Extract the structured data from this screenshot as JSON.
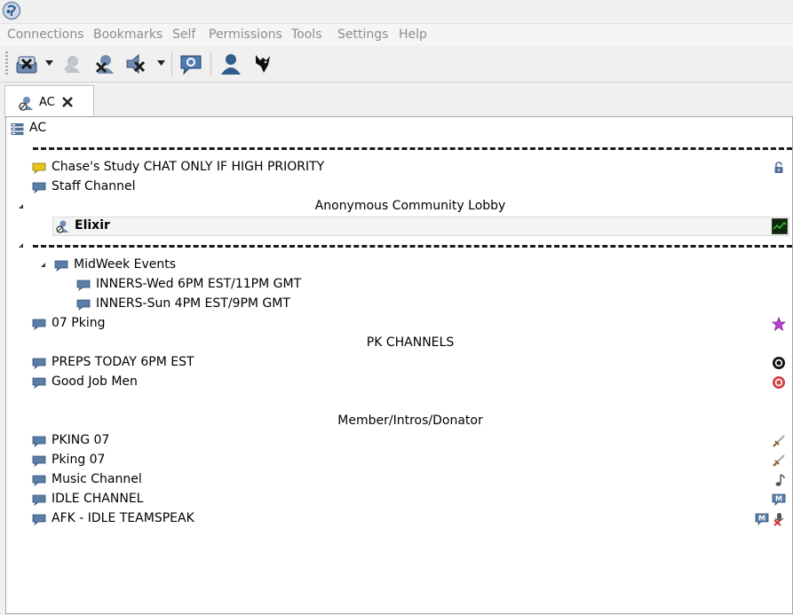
{
  "menu": {
    "connections": "Connections",
    "bookmarks": "Bookmarks",
    "self": "Self",
    "permissions": "Permissions",
    "tools": "Tools",
    "settings": "Settings",
    "help": "Help"
  },
  "tab": {
    "label": "AC"
  },
  "tree": {
    "server_name": "AC",
    "channels": {
      "chase_study": "Chase's Study CHAT ONLY IF HIGH PRIORITY",
      "staff": "Staff Channel",
      "lobby_header": "Anonymous Community Lobby",
      "client_elixir": "Elixir",
      "midweek": "MidWeek Events",
      "inners_wed": "INNERS-Wed 6PM EST/11PM GMT",
      "inners_sun": "INNERS-Sun 4PM EST/9PM GMT",
      "pking07": "07 Pking",
      "pk_header": "PK CHANNELS",
      "preps": "PREPS TODAY 6PM EST",
      "good_job": "Good Job Men",
      "member_header": "Member/Intros/Donator",
      "pking_07_caps": "PKING 07",
      "pking_07_mixed": "Pking 07",
      "music": "Music Channel",
      "idle": "IDLE CHANNEL",
      "afk": "AFK - IDLE TEAMSPEAK"
    }
  },
  "colors": {
    "channel_icon": "#5b7ea6",
    "channel_icon_highlight": "#e6c619",
    "star": "#c03fd6",
    "menu_text_disabled": "#8d8d8d"
  }
}
